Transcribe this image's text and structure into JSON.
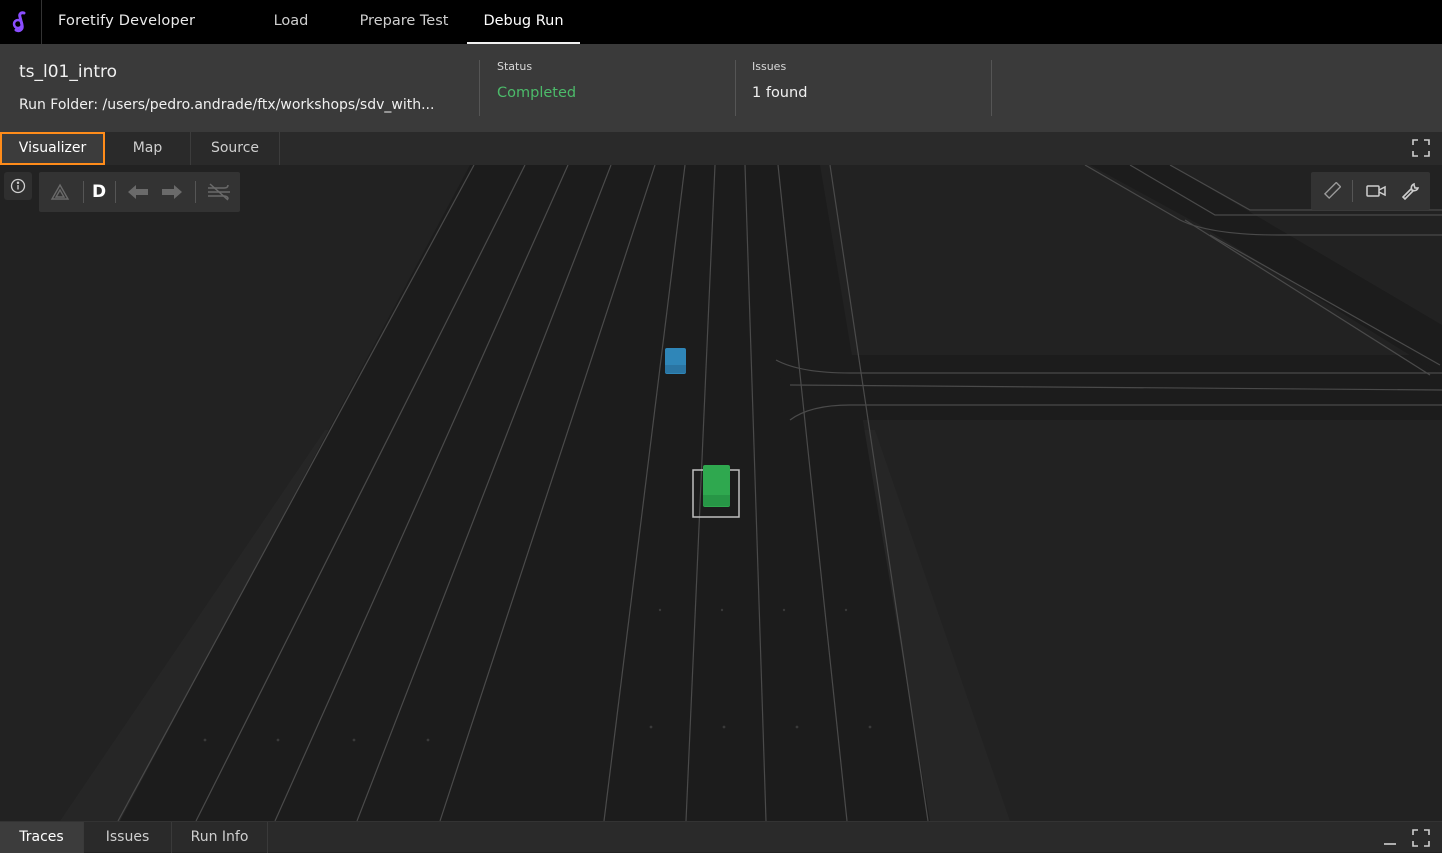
{
  "app": {
    "title": "Foretify Developer",
    "nav_tabs": [
      {
        "label": "Load",
        "active": false
      },
      {
        "label": "Prepare Test",
        "active": false
      },
      {
        "label": "Debug Run",
        "active": true
      }
    ]
  },
  "run": {
    "name": "ts_l01_intro",
    "folder": "Run Folder: /users/pedro.andrade/ftx/workshops/sdv_with...",
    "status_label": "Status",
    "status_value": "Completed",
    "issues_label": "Issues",
    "issues_value": "1 found"
  },
  "view_tabs": [
    {
      "label": "Visualizer",
      "active": true
    },
    {
      "label": "Map",
      "active": false
    },
    {
      "label": "Source",
      "active": false
    }
  ],
  "visualizer": {
    "driver_mode": "D",
    "left_tools": [
      "warning-icon",
      "driver-mode",
      "arrow-left-icon",
      "arrow-right-icon",
      "wind-icon"
    ],
    "right_tools": [
      "ruler-icon",
      "camera-icon",
      "wrench-icon"
    ],
    "ego_vehicle_color": "#2fa84f",
    "other_vehicle_color": "#2f86b8"
  },
  "bottom_tabs": [
    {
      "label": "Traces",
      "active": true
    },
    {
      "label": "Issues",
      "active": false
    },
    {
      "label": "Run Info",
      "active": false
    }
  ],
  "colors": {
    "status_completed": "#4cbb6a",
    "accent_orange": "#ff8c1a",
    "brand_purple": "#8a4dff"
  }
}
